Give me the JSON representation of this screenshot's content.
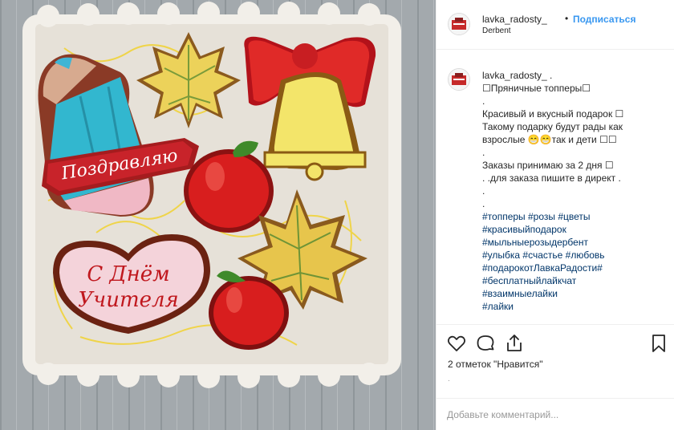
{
  "post": {
    "username": "lavka_radosty_",
    "separator": "•",
    "follow_label": "Подписаться",
    "location": "Derbent"
  },
  "caption": {
    "username": "lavka_radosty_ .",
    "lines": [
      "☐Пряничные топперы☐",
      ".",
      "Красивый и вкусный подарок ☐",
      "Такому подарку будут рады как",
      "взрослые 😁😁так и дети ☐☐",
      ".",
      "Заказы принимаю за 2 дня ☐",
      ". .для заказа пишите в директ .",
      ".",
      "."
    ],
    "hashtags": [
      "#топперы #розы #цветы",
      "#красивыйподарок",
      "#мыльныерозыдербент",
      "#улыбка #счастье #любовь",
      "#подарокотЛавкаРадости#",
      "#бесплатныйлайкчат",
      "#взаимныелайки",
      "#лайки"
    ]
  },
  "actions": {
    "like_icon": "heart-icon",
    "comment_icon": "comment-icon",
    "share_icon": "share-icon",
    "save_icon": "bookmark-icon",
    "likes_text": "2 отметок \"Нравится\"",
    "small_dot": "."
  },
  "comment": {
    "placeholder": "Добавьте комментарий..."
  },
  "photo": {
    "ribbon_text": "Поздравляю",
    "heart_text_line1": "С Днём",
    "heart_text_line2": "Учителя"
  },
  "colors": {
    "follow": "#3897f0",
    "hashtag": "#003569",
    "border": "#efefef"
  }
}
